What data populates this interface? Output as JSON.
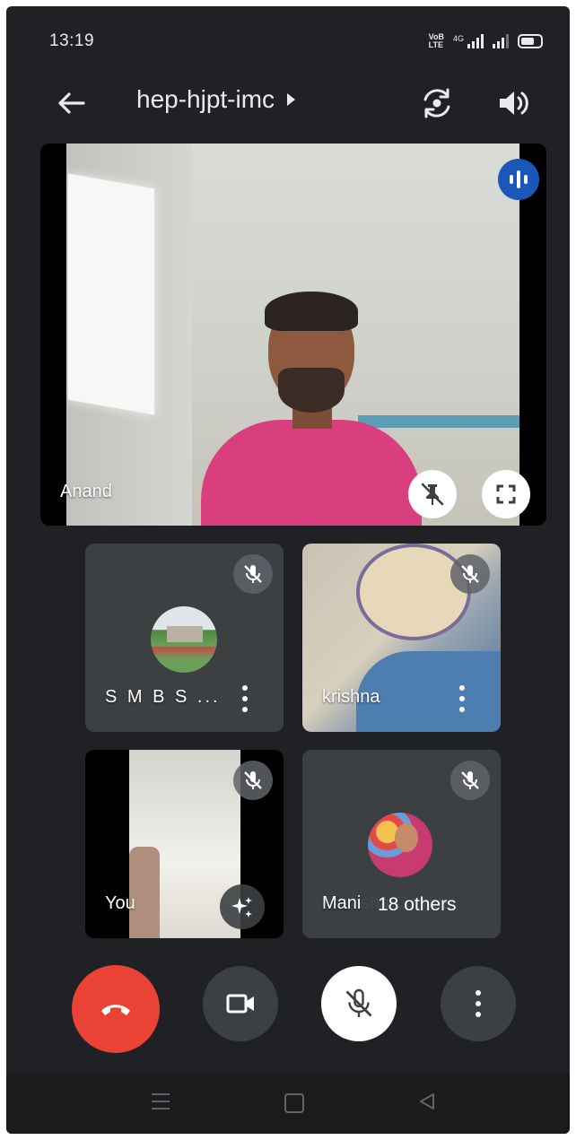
{
  "status_bar": {
    "time": "13:19",
    "volte_top": "VoB",
    "volte_bottom": "LTE",
    "network_tag": "4G"
  },
  "top_bar": {
    "meeting_code": "hep-hjpt-imc",
    "back_icon": "arrow-left-icon",
    "flip_camera_icon": "flip-camera-icon",
    "speaker_icon": "speaker-icon"
  },
  "main_tile": {
    "name": "Anand",
    "speaking_icon": "audio-level-icon",
    "unpin_icon": "unpin-icon",
    "fullscreen_icon": "fullscreen-icon"
  },
  "participants": [
    {
      "name": "S M B S ...",
      "muted": true,
      "avatar": "photo"
    },
    {
      "name": "krishna",
      "muted": true,
      "avatar": "video"
    },
    {
      "name": "You",
      "muted": true,
      "avatar": "video"
    },
    {
      "name": "Manisha Gavale",
      "muted": true,
      "avatar": "photo"
    }
  ],
  "others_label": "18 others",
  "controls": {
    "hangup_icon": "phone-hangup-icon",
    "camera_icon": "video-camera-icon",
    "mic_icon": "mic-off-icon",
    "more_icon": "more-vert-icon"
  },
  "colors": {
    "background": "#202124",
    "tile": "#3c4043",
    "hangup": "#ea4335",
    "speaking": "#1a57b8"
  }
}
